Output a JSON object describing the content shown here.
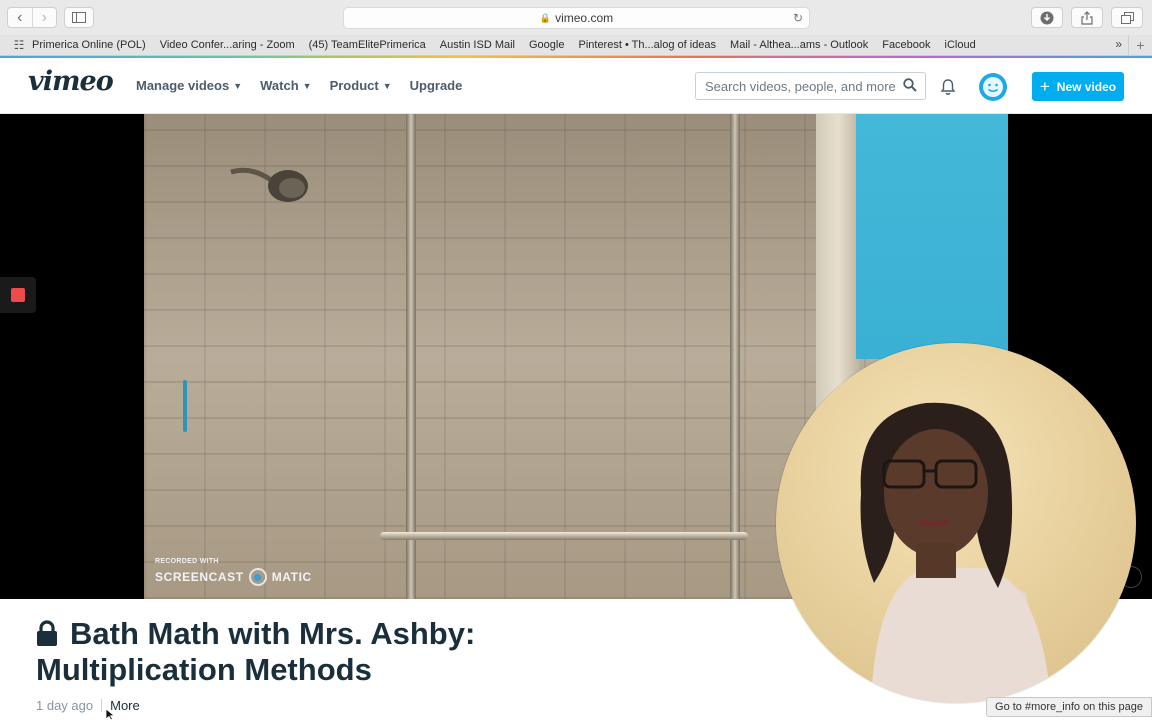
{
  "browser": {
    "url": "vimeo.com",
    "bookmarks": [
      "Primerica Online (POL)",
      "Video Confer...aring - Zoom",
      "(45) TeamElitePrimerica",
      "Austin ISD Mail",
      "Google",
      "Pinterest • Th...alog of ideas",
      "Mail - Althea...ams - Outlook",
      "Facebook",
      "iCloud"
    ],
    "status_tip": "Go to #more_info on this page"
  },
  "header": {
    "logo": "vimeo",
    "nav": [
      "Manage videos",
      "Watch",
      "Product",
      "Upgrade"
    ],
    "search_placeholder": "Search videos, people, and more",
    "new_video_label": "New video"
  },
  "video": {
    "watermark_small": "RECORDED WITH",
    "watermark_left": "SCREENCAST",
    "watermark_right": "MATIC"
  },
  "details": {
    "title": "Bath Math with Mrs. Ashby: Multiplication Methods",
    "posted": "1 day ago",
    "more_label": "More"
  },
  "colors": {
    "brand_text": "#1a2e3b",
    "accent": "#00adef",
    "record": "#f04b4b"
  }
}
